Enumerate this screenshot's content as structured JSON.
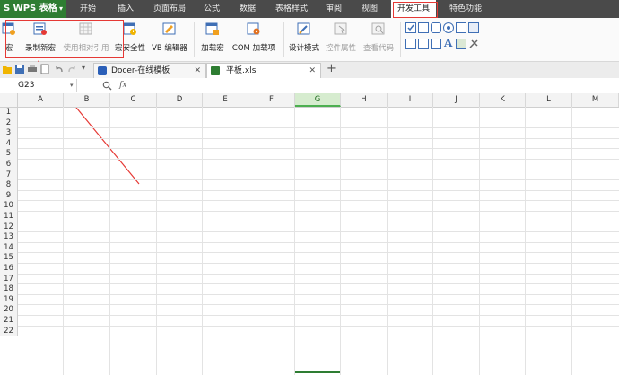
{
  "app": {
    "logo_label": "S WPS 表格"
  },
  "menu": {
    "tabs": [
      "开始",
      "插入",
      "页面布局",
      "公式",
      "数据",
      "表格样式",
      "审阅",
      "视图",
      "开发工具",
      "特色功能"
    ],
    "active_tab": "开发工具"
  },
  "ribbon": {
    "macro_label": "宏",
    "record_macro_label": "录制新宏",
    "relative_ref_label": "使用相对引用",
    "macro_security_label": "宏安全性",
    "vb_editor_label": "VB 编辑器",
    "addins_label": "加载宏",
    "com_addins_label": "COM 加载项",
    "design_mode_label": "设计模式",
    "control_props_label": "控件属性",
    "view_code_label": "查看代码"
  },
  "doc_tabs": [
    {
      "label": "Docer-在线模板"
    },
    {
      "label": "平板.xls"
    }
  ],
  "formula_bar": {
    "cell_ref": "G23",
    "fx_label": "fx",
    "formula": ""
  },
  "grid": {
    "columns": [
      "A",
      "B",
      "C",
      "D",
      "E",
      "F",
      "G",
      "H",
      "I",
      "J",
      "K",
      "L",
      "M"
    ],
    "selected_column": "G",
    "rows": [
      "1",
      "2",
      "3",
      "4",
      "5",
      "6",
      "7",
      "8",
      "9",
      "10",
      "11",
      "12",
      "13",
      "14",
      "15",
      "16",
      "17",
      "18",
      "19",
      "20",
      "21",
      "22"
    ]
  },
  "colors": {
    "menubar_bg": "#4a4a4a",
    "logo_bg": "#2e7d32",
    "annotation_red": "#e53935",
    "selection_green": "#4caf50"
  }
}
